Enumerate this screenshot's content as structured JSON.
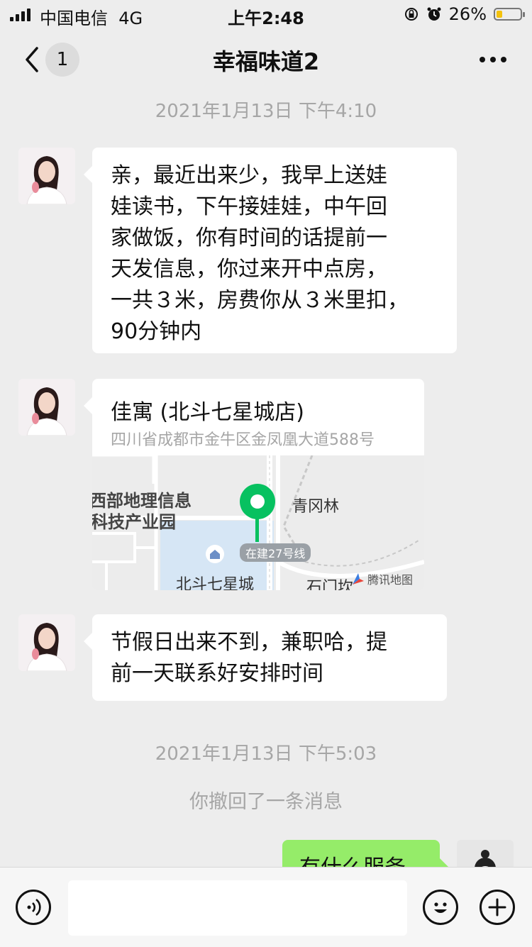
{
  "status_bar": {
    "carrier": "中国电信",
    "network": "4G",
    "time": "上午2:48",
    "battery": "26%",
    "battery_level": 0.26
  },
  "nav": {
    "unread_count": "1",
    "title": "幸福味道2"
  },
  "messages": {
    "timestamp_1": "2021年1月13日 下午4:10",
    "msg_1_lines": [
      "亲，最近出来少，我早上送娃",
      "娃读书，下午接娃娃，中午回",
      "家做饭，你有时间的话提前一",
      "天发信息，你过来开中点房，",
      "一共３米，房费你从３米里扣，",
      "90分钟内"
    ],
    "location": {
      "name": "佳寓 (北斗七星城店)",
      "address": "四川省成都市金牛区金凤凰大道588号",
      "map_labels": {
        "park": "西部地理信息",
        "park2": "科技产业园",
        "qinggang": "青冈林",
        "line": "在建27号线",
        "beidou": "北斗七星城",
        "shimen": "石门坎",
        "provider": "腾讯地图"
      }
    },
    "msg_2_lines": [
      "节假日出来不到，兼职哈，提",
      "前一天联系好安排时间"
    ],
    "timestamp_2": "2021年1月13日 下午5:03",
    "recall_notice": "你撤回了一条消息",
    "msg_3": "有什么服务"
  },
  "colors": {
    "background": "#ededed",
    "bubble_self": "#95ec69",
    "map_pin": "#07c160",
    "battery": "#f4c20d"
  },
  "icons": [
    "back-icon",
    "more-icon",
    "voice-icon",
    "emoji-icon",
    "plus-icon",
    "map-pin-icon"
  ]
}
